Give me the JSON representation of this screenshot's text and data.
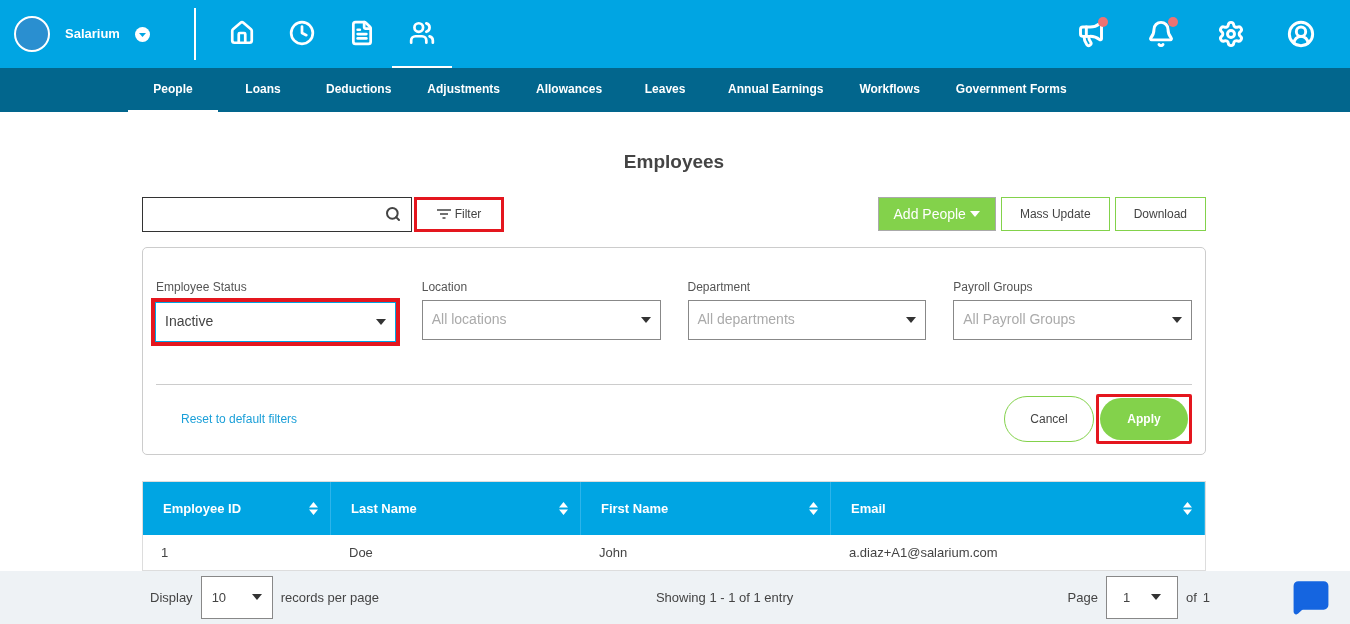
{
  "brand": {
    "name": "Salarium"
  },
  "nav_icons": [
    {
      "kind": "home",
      "selected": false
    },
    {
      "kind": "clock",
      "selected": false
    },
    {
      "kind": "document",
      "selected": false
    },
    {
      "kind": "people",
      "selected": true
    }
  ],
  "top_icons": [
    {
      "kind": "megaphone",
      "badge": true
    },
    {
      "kind": "bell",
      "badge": true
    },
    {
      "kind": "settings",
      "badge": false
    },
    {
      "kind": "account",
      "badge": false
    }
  ],
  "tabs": [
    {
      "label": "People",
      "selected": true
    },
    {
      "label": "Loans",
      "selected": false
    },
    {
      "label": "Deductions",
      "selected": false
    },
    {
      "label": "Adjustments",
      "selected": false
    },
    {
      "label": "Allowances",
      "selected": false
    },
    {
      "label": "Leaves",
      "selected": false
    },
    {
      "label": "Annual Earnings",
      "selected": false
    },
    {
      "label": "Workflows",
      "selected": false
    },
    {
      "label": "Government Forms",
      "selected": false
    }
  ],
  "title": "Employees",
  "filter_button": {
    "label": "Filter",
    "highlighted": true
  },
  "actions": [
    {
      "label": "Add People",
      "kind": "primary"
    },
    {
      "label": "Mass Update",
      "kind": "outline"
    },
    {
      "label": "Download",
      "kind": "outline"
    }
  ],
  "filters": [
    {
      "label": "Employee Status",
      "value": "Inactive",
      "highlighted": true
    },
    {
      "label": "Location",
      "placeholder": "All locations",
      "highlighted": false
    },
    {
      "label": "Department",
      "placeholder": "All departments",
      "highlighted": false
    },
    {
      "label": "Payroll Groups",
      "placeholder": "All Payroll Groups",
      "highlighted": false
    }
  ],
  "reset_link": "Reset to default filters",
  "cancel_button": {
    "label": "Cancel"
  },
  "apply_button": {
    "label": "Apply",
    "highlighted": true
  },
  "table": {
    "columns": [
      "Employee ID",
      "Last Name",
      "First Name",
      "Email"
    ],
    "rows": [
      [
        "1",
        "Doe",
        "John",
        "a.diaz+A1@salarium.com"
      ]
    ]
  },
  "footer": {
    "display_label": "Display",
    "page_size": "10",
    "records_label": "records per page",
    "showing": "Showing 1 - 1 of 1 entry",
    "page_label": "Page",
    "page": "1",
    "of_label": "of",
    "total_pages": "1"
  }
}
